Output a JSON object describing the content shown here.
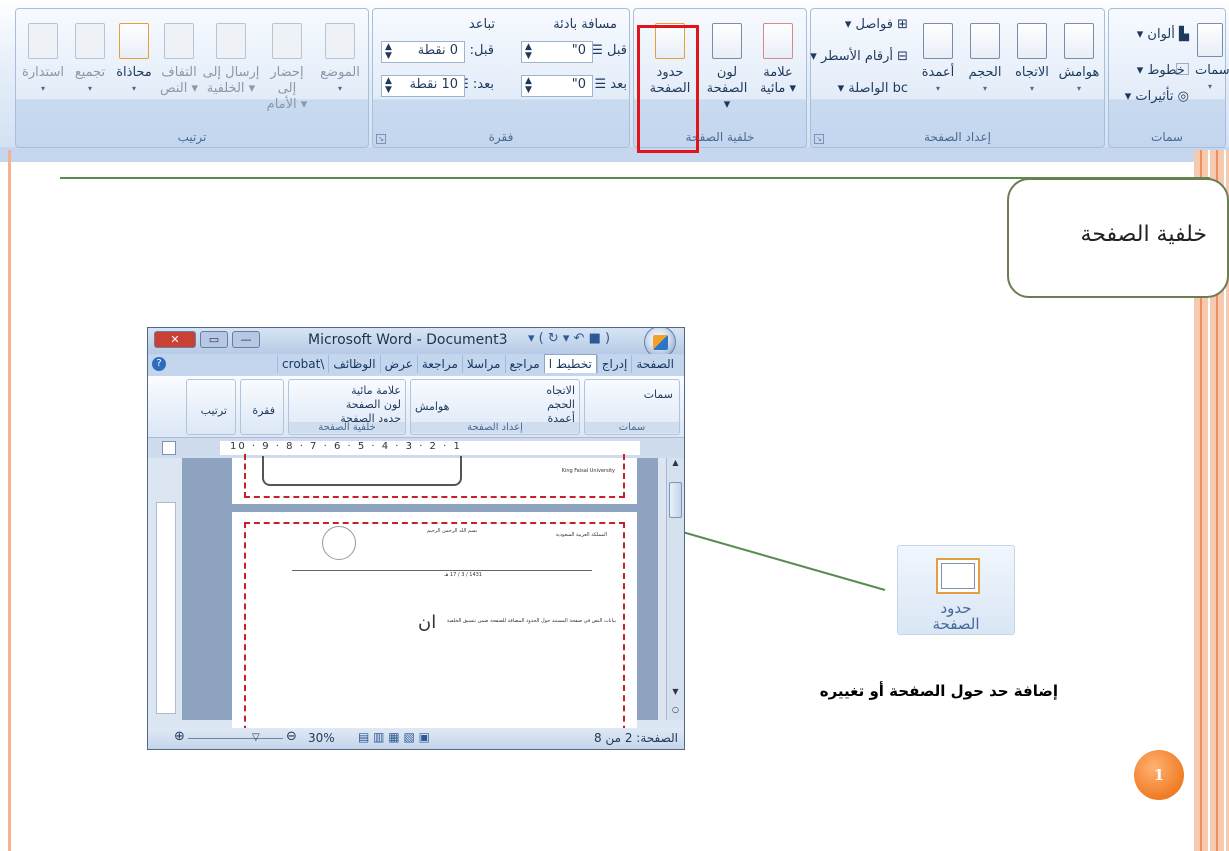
{
  "ribbon": {
    "groups": {
      "themes": {
        "label": "سمات",
        "themes_btn": "سمات",
        "colors": "ألوان",
        "fonts": "خطوط",
        "effects": "تأثيرات"
      },
      "page_setup": {
        "label": "إعداد الصفحة",
        "margins": "هوامش",
        "orientation": "الاتجاه",
        "size": "الحجم",
        "columns": "أعمدة",
        "breaks": "فواصل",
        "line_numbers": "أرقام الأسطر",
        "hyphenation": "الواصلة"
      },
      "page_background": {
        "label": "خلفية الصفحة",
        "watermark_line1": "علامة",
        "watermark_line2": "مائية",
        "page_color_line1": "لون",
        "page_color_line2": "الصفحة",
        "page_borders_line1": "حدود",
        "page_borders_line2": "الصفحة"
      },
      "paragraph": {
        "label": "فقرة",
        "indent": "مسافة بادئة",
        "spacing": "تباعد",
        "indent_before_label": "قبل",
        "indent_before_value": "0\"",
        "indent_after_label": "بعد",
        "indent_after_value": "0\"",
        "spacing_before_label": "قبل:",
        "spacing_before_value": "0 نقطة",
        "spacing_after_label": "بعد:",
        "spacing_after_value": "10 نقطة"
      },
      "arrange": {
        "label": "ترتيب",
        "position": "الموضع",
        "bring_front_1": "إحضار إلى",
        "bring_front_2": "الأمام",
        "send_back_1": "إرسال إلى",
        "send_back_2": "الخلفية",
        "wrap_1": "التفاف",
        "wrap_2": "النص",
        "align": "محاذاة",
        "group": "تجميع",
        "rotate": "استدارة"
      }
    }
  },
  "slide": {
    "heading": "خلفية الصفحة",
    "caption": "إضافة حد حول الصفحة أو تغييره",
    "callout_label_1": "حدود",
    "callout_label_2": "الصفحة",
    "page_number": "1"
  },
  "word_window": {
    "title": "Microsoft Word - Document3",
    "tabs": [
      "الصفحة",
      "إدراج",
      "تخطيط ا",
      "مراجع",
      "مراسلا",
      "مراجعة",
      "عرض",
      "الوظائف",
      "\\crobat"
    ],
    "active_tab": "تخطيط ا",
    "themes": "سمات",
    "themes_group": "سمات",
    "margins": "هوامش",
    "orientation": "الاتجاه",
    "size": "الحجم",
    "columns": "أعمدة",
    "page_setup_group": "إعداد الصفحة",
    "watermark": "علامة مائية",
    "page_color": "لون الصفحة",
    "page_borders": "حدود الصفحة",
    "page_background_group": "خلفية الصفحة",
    "paragraph": "فقرة",
    "arrange": "ترتيب",
    "ruler_text": "10  ·  9  ·  8  ·  7  ·  6  ·  5  ·  4  ·  3  ·  2  ·  1",
    "page_info": "الصفحة: 2 من 8",
    "zoom": "30%",
    "doc_header_right": "المملكة العربية السعودية",
    "doc_header_center": "بسم الله الرحمن الرحيم",
    "doc_university": "King Faisal University",
    "doc_date": "1431 / 3 / 17 هـ",
    "doc_big_letters": "ان",
    "doc_body": "بيانات النص في صفحة المستند حول الحدود المضافة للصفحة ضمن تنسيق الخلفية"
  }
}
